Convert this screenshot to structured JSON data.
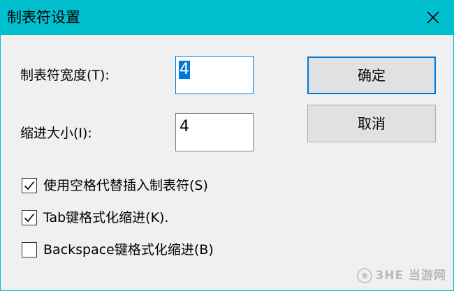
{
  "window": {
    "title": "制表符设置",
    "close_icon": "close-icon",
    "titlebar_color": "#00c0cf"
  },
  "fields": {
    "tab_width_label": "制表符宽度(T):",
    "tab_width_value": "4",
    "indent_size_label": "缩进大小(I):",
    "indent_size_value": "4"
  },
  "buttons": {
    "ok_label": "确定",
    "cancel_label": "取消"
  },
  "options": [
    {
      "label": "使用空格代替插入制表符(S)",
      "checked": true
    },
    {
      "label": "Tab键格式化缩进(K).",
      "checked": true
    },
    {
      "label": "Backspace键格式化缩进(B)",
      "checked": false
    }
  ],
  "watermark": {
    "text": "3HE 当游网"
  }
}
